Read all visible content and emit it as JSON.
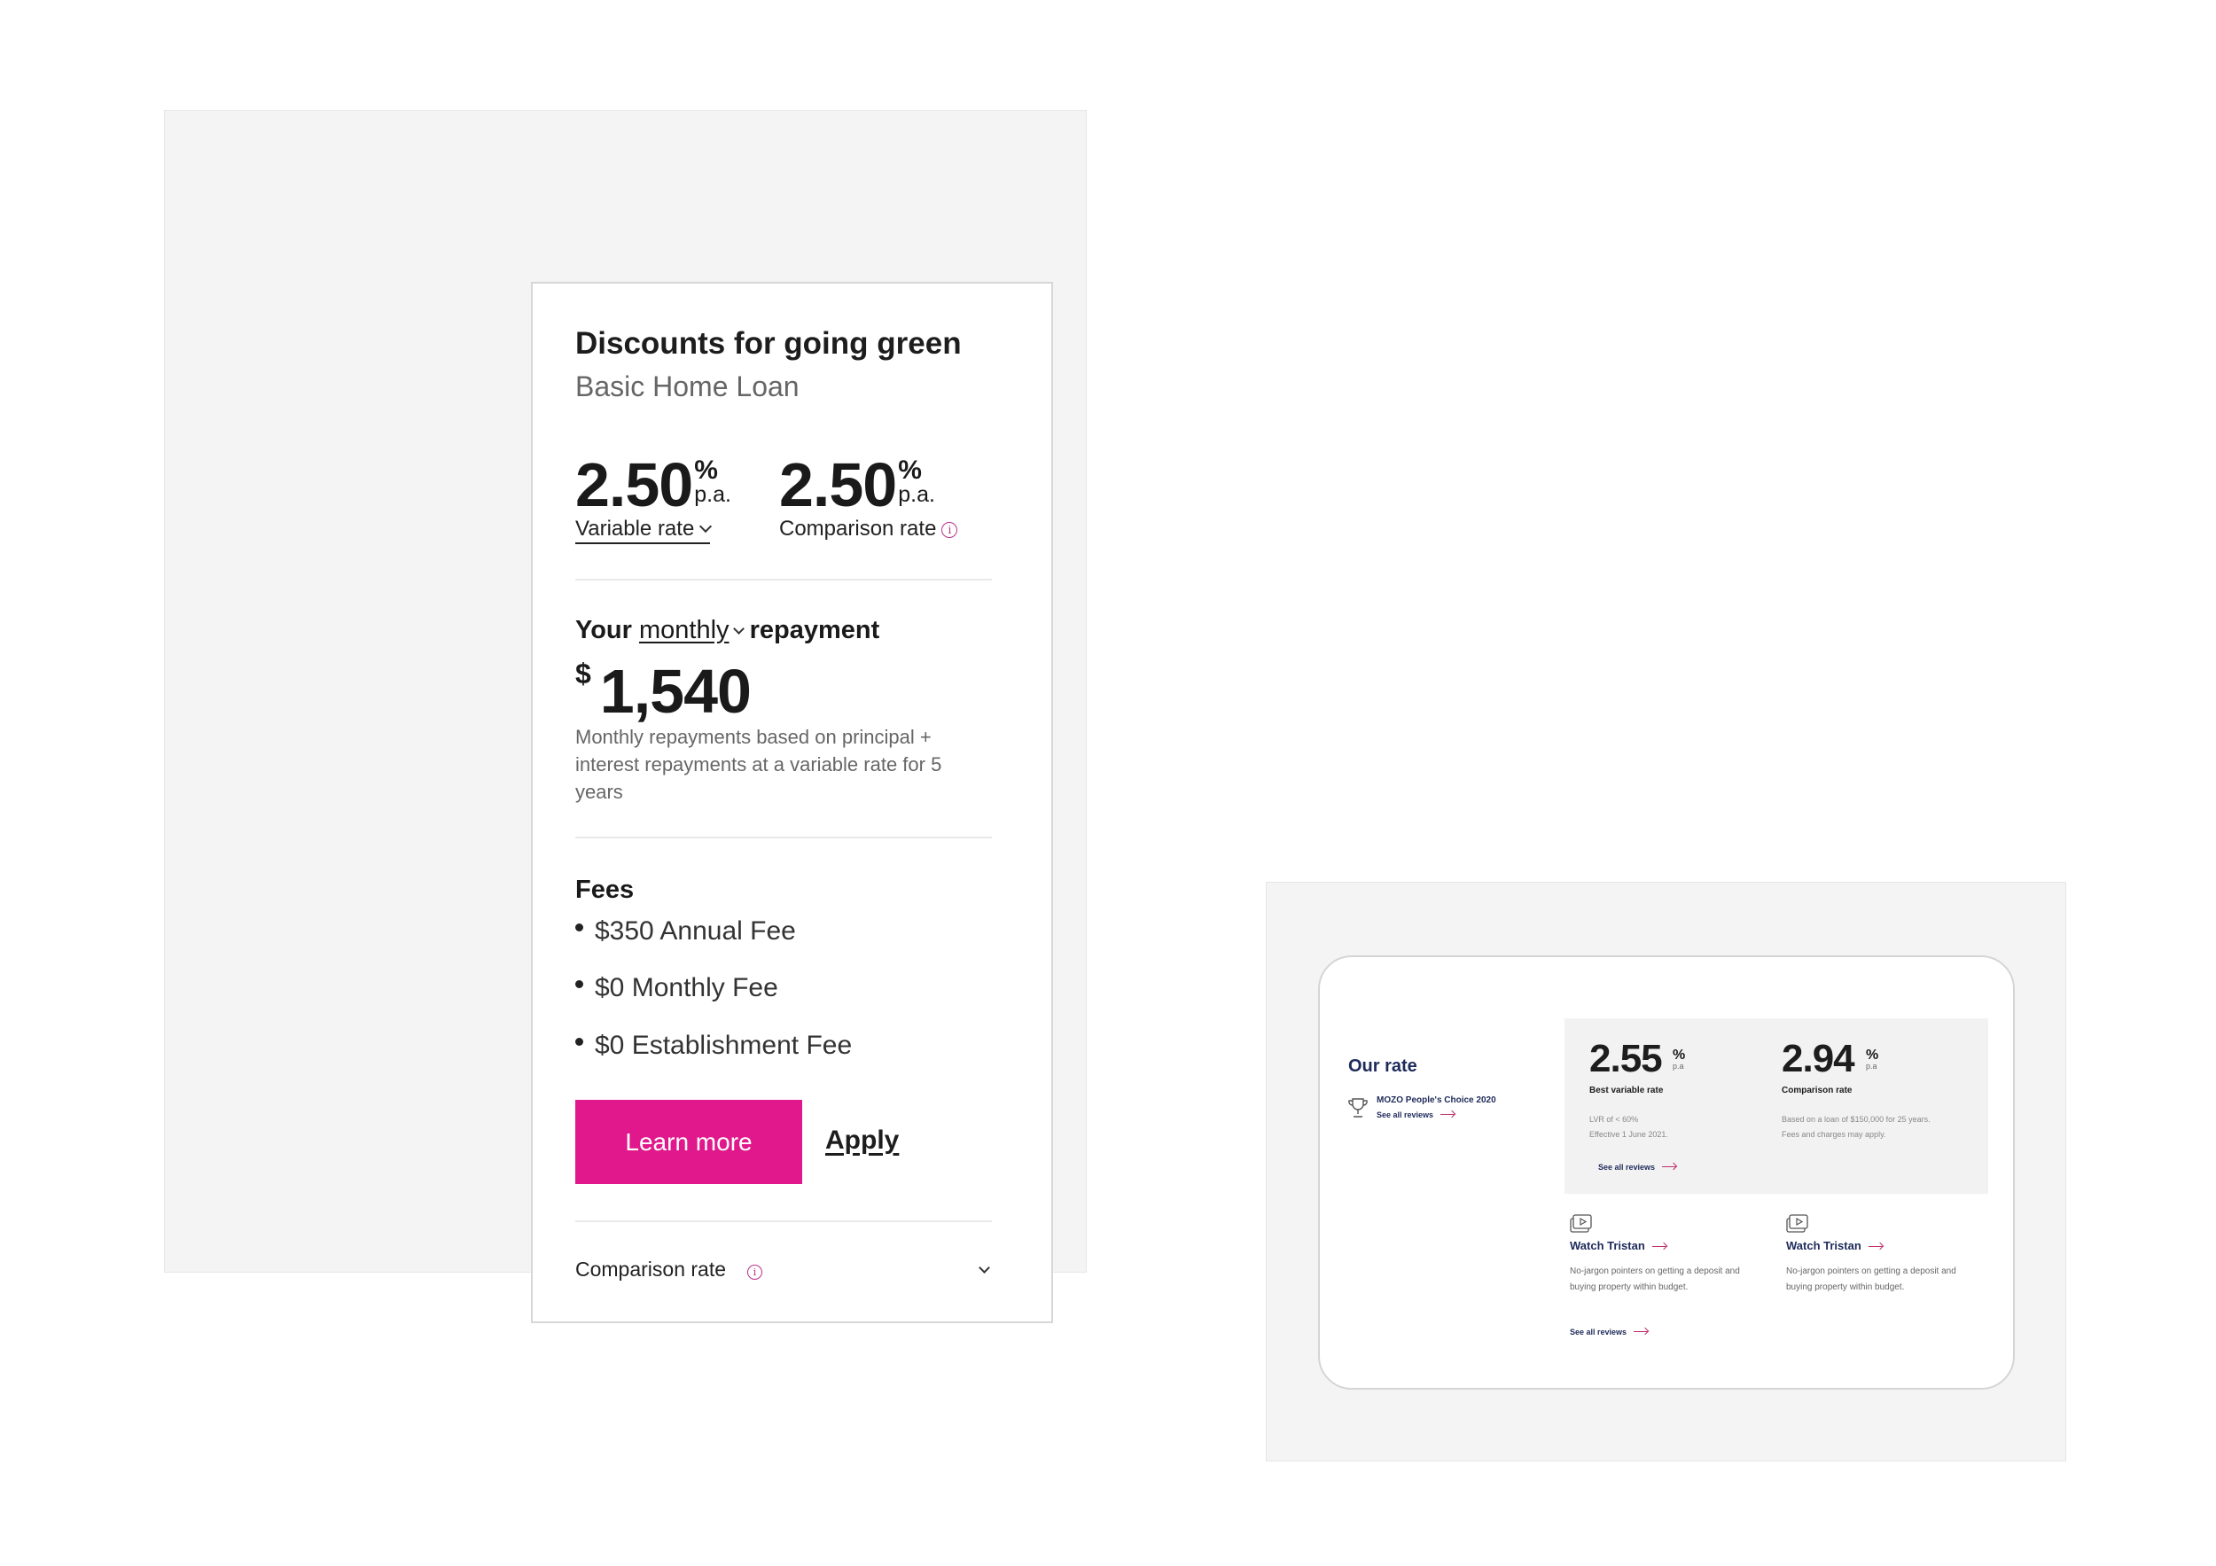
{
  "left_card": {
    "title": "Discounts for going green",
    "subtitle": "Basic Home Loan",
    "variable_rate": {
      "value": "2.50",
      "percent": "%",
      "pa": "p.a.",
      "label": "Variable rate"
    },
    "comparison_rate": {
      "value": "2.50",
      "percent": "%",
      "pa": "p.a.",
      "label": "Comparison rate"
    },
    "repayment": {
      "prefix": "Your",
      "period": "monthly",
      "suffix": "repayment",
      "currency": "$",
      "amount": "1,540",
      "description": "Monthly repayments based on principal + interest repayments at a variable rate for 5 years"
    },
    "fees": {
      "heading": "Fees",
      "items": [
        "$350 Annual Fee",
        "$0 Monthly Fee",
        "$0 Establishment Fee"
      ]
    },
    "learn_more_label": "Learn more",
    "apply_label": "Apply",
    "comparison_row_label": "Comparison rate",
    "info_glyph": "i",
    "colors": {
      "accent": "#e0188c",
      "info": "#b9318a"
    }
  },
  "right_card": {
    "our_rate_label": "Our rate",
    "award": {
      "title": "MOZO People's Choice 2020",
      "link": "See all reviews",
      "icon": "trophy-icon"
    },
    "best_variable": {
      "value": "2.55",
      "percent": "%",
      "pa": "p.a",
      "label": "Best variable rate",
      "note_line1": "LVR of < 60%",
      "note_line2": "Effective 1 June 2021."
    },
    "comparison": {
      "value": "2.94",
      "percent": "%",
      "pa": "p.a",
      "label": "Comparison rate",
      "note": "Based on a loan of $150,000 for 25 years. Fees and charges may apply."
    },
    "rate_box_link": "See all reviews",
    "videos": [
      {
        "title": "Watch Tristan",
        "description": "No-jargon pointers on getting a deposit and buying property within budget.",
        "link": "See all reviews",
        "icon": "video-icon"
      },
      {
        "title": "Watch Tristan",
        "description": "No-jargon pointers on getting a deposit and buying property within budget.",
        "icon": "video-icon"
      }
    ],
    "colors": {
      "navy": "#1e2a5a",
      "arrow": "#c0306d"
    }
  }
}
